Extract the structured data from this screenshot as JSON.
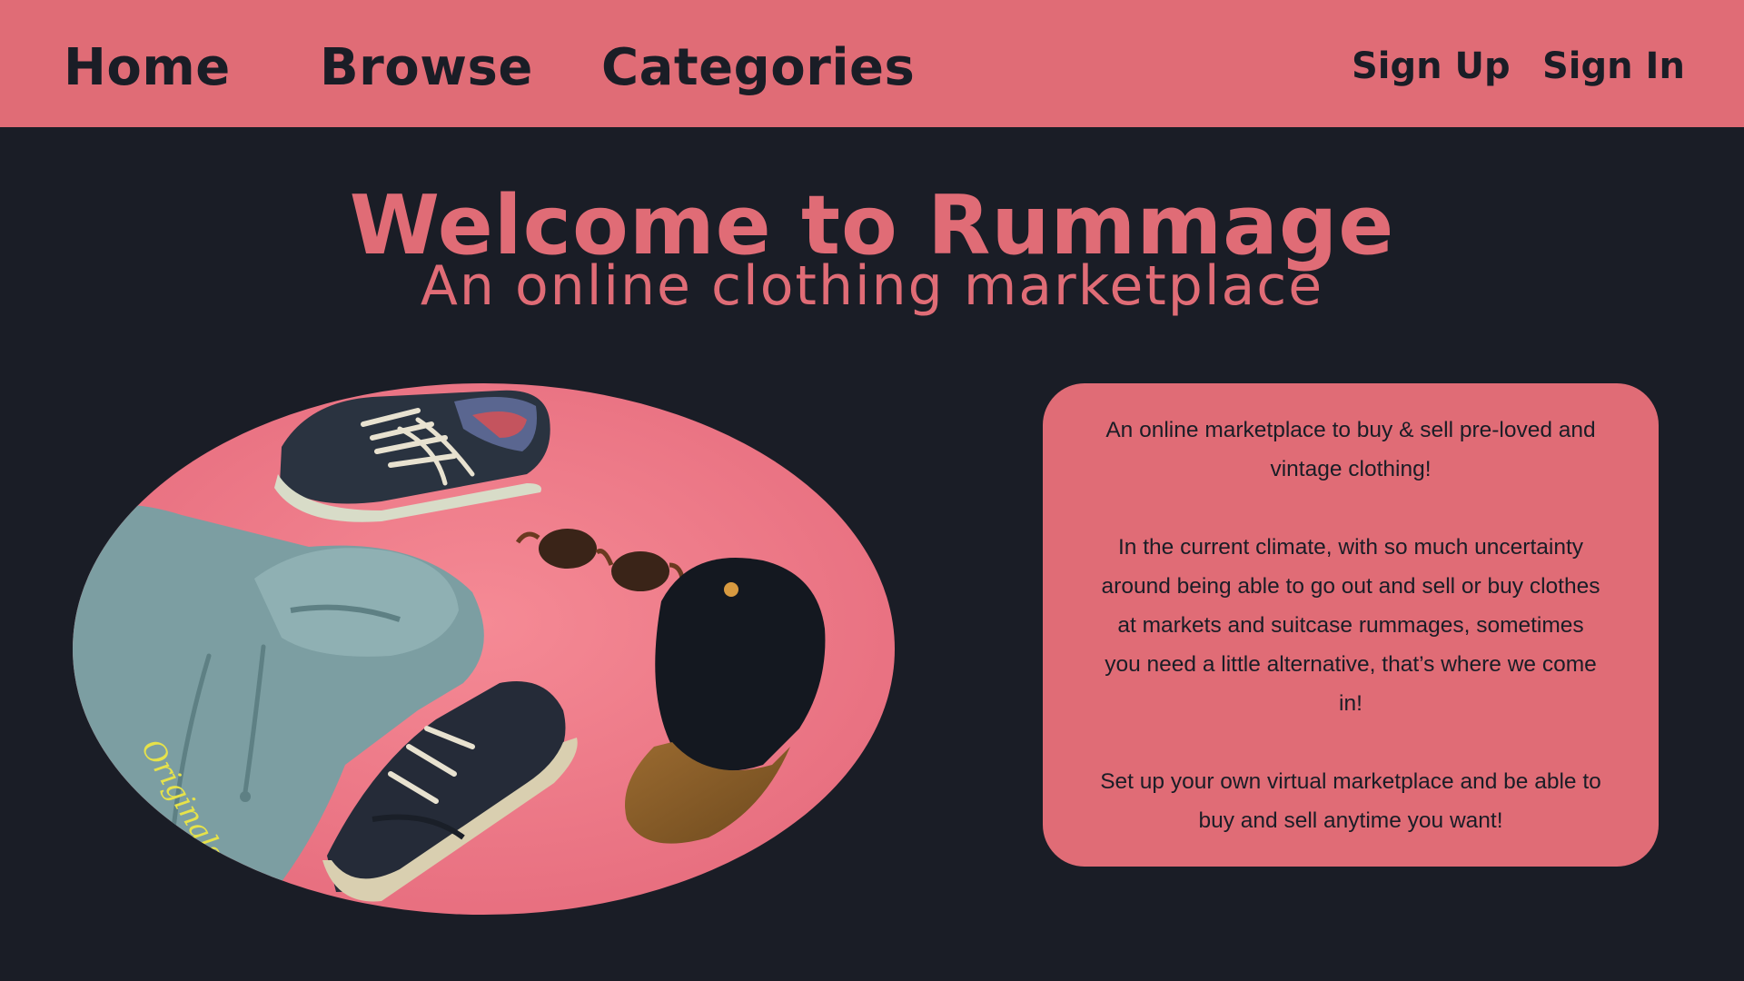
{
  "nav": {
    "home": "Home",
    "browse": "Browse",
    "categories": "Categories",
    "sign_up": "Sign Up",
    "sign_in": "Sign In"
  },
  "hero": {
    "title": "Welcome to Rummage",
    "subtitle": "An online clothing marketplace",
    "image_description_icon": "clothing-flatlay-image",
    "hoodie_print": "Originals"
  },
  "info_card": {
    "paragraphs": [
      "An online marketplace to buy & sell pre-loved and vintage clothing!",
      "In the current climate, with so much uncertainty around being able to go out and sell or buy clothes at markets and suitcase rummages, sometimes you need a little alternative, that’s where we come in!",
      "Set up your own virtual marketplace and be able to buy and sell anytime you want!"
    ]
  },
  "colors": {
    "accent": "#e06c76",
    "background": "#1a1d26",
    "text_dark": "#1a1d26",
    "image_pink": "#f07a86"
  }
}
